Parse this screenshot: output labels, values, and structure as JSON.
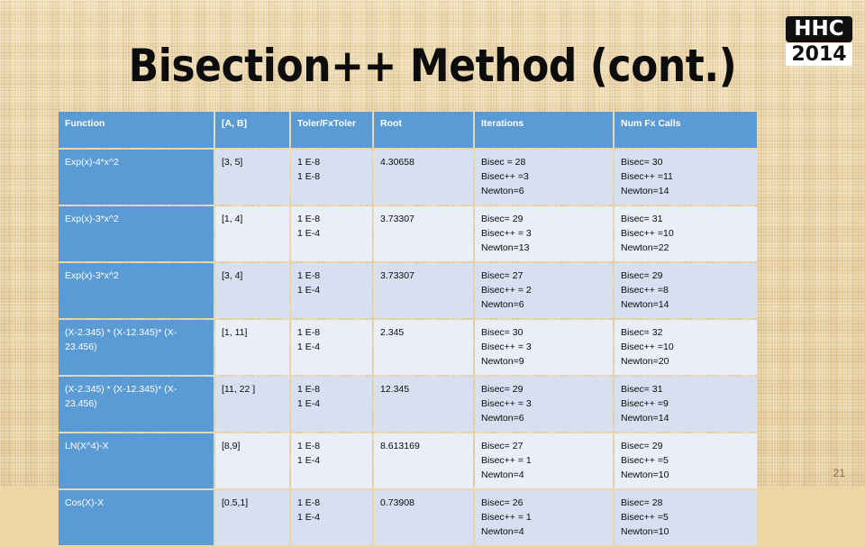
{
  "slide": {
    "title": "Bisection++ Method (cont.)",
    "page_number": "21",
    "background_color": "#f0d9a8",
    "accent_color": "#5b9bd5"
  },
  "logo": {
    "name": "HHC",
    "year": "2014"
  },
  "table": {
    "columns": [
      "Function",
      "[A, B]",
      "Toler/FxToler",
      "Root",
      "Iterations",
      "Num Fx Calls"
    ],
    "rows": [
      {
        "function": "Exp(x)-4*x^2",
        "interval": "[3, 5]",
        "toler": [
          "1 E-8",
          "1 E-8"
        ],
        "root": "4.30658",
        "iterations": [
          "Bisec = 28",
          "Bisec++ =3",
          "Newton=6"
        ],
        "num_fx_calls": [
          "Bisec= 30",
          "Bisec++ =11",
          "Newton=14"
        ]
      },
      {
        "function": "Exp(x)-3*x^2",
        "interval": "[1, 4]",
        "toler": [
          "1 E-8",
          "1 E-4"
        ],
        "root": "3.73307",
        "iterations": [
          "Bisec= 29",
          "Bisec++ = 3",
          "Newton=13"
        ],
        "num_fx_calls": [
          "Bisec= 31",
          "Bisec++ =10",
          "Newton=22"
        ]
      },
      {
        "function": "Exp(x)-3*x^2",
        "interval": "[3, 4]",
        "toler": [
          "1 E-8",
          "1 E-4"
        ],
        "root": "3.73307",
        "iterations": [
          "Bisec= 27",
          "Bisec++ = 2",
          "Newton=6"
        ],
        "num_fx_calls": [
          "Bisec= 29",
          "Bisec++ =8",
          "Newton=14"
        ]
      },
      {
        "function": "(X-2.345) * (X-12.345)* (X-23.456)",
        "interval": "[1, 11]",
        "toler": [
          "1 E-8",
          "1 E-4"
        ],
        "root": "2.345",
        "iterations": [
          "Bisec= 30",
          "Bisec++ = 3",
          "Newton=9"
        ],
        "num_fx_calls": [
          "Bisec= 32",
          "Bisec++ =10",
          "Newton=20"
        ]
      },
      {
        "function": "(X-2.345) * (X-12.345)* (X-23.456)",
        "interval": "[11, 22 ]",
        "toler": [
          "1 E-8",
          "1 E-4"
        ],
        "root": "12.345",
        "iterations": [
          "Bisec= 29",
          "Bisec++ = 3",
          "Newton=6"
        ],
        "num_fx_calls": [
          "Bisec= 31",
          "Bisec++ =9",
          "Newton=14"
        ]
      },
      {
        "function": "LN(X^4)-X",
        "interval": "[8,9]",
        "toler": [
          "1 E-8",
          "1 E-4"
        ],
        "root": "8.613169",
        "iterations": [
          "Bisec= 27",
          "Bisec++ = 1",
          "Newton=4"
        ],
        "num_fx_calls": [
          "Bisec= 29",
          "Bisec++ =5",
          "Newton=10"
        ]
      },
      {
        "function": "Cos(X)-X",
        "interval": "[0.5,1]",
        "toler": [
          "1 E-8",
          "1 E-4"
        ],
        "root": "0.73908",
        "iterations": [
          "Bisec= 26",
          "Bisec++ = 1",
          "Newton=4"
        ],
        "num_fx_calls": [
          "Bisec= 28",
          "Bisec++ =5",
          "Newton=10"
        ]
      }
    ]
  }
}
